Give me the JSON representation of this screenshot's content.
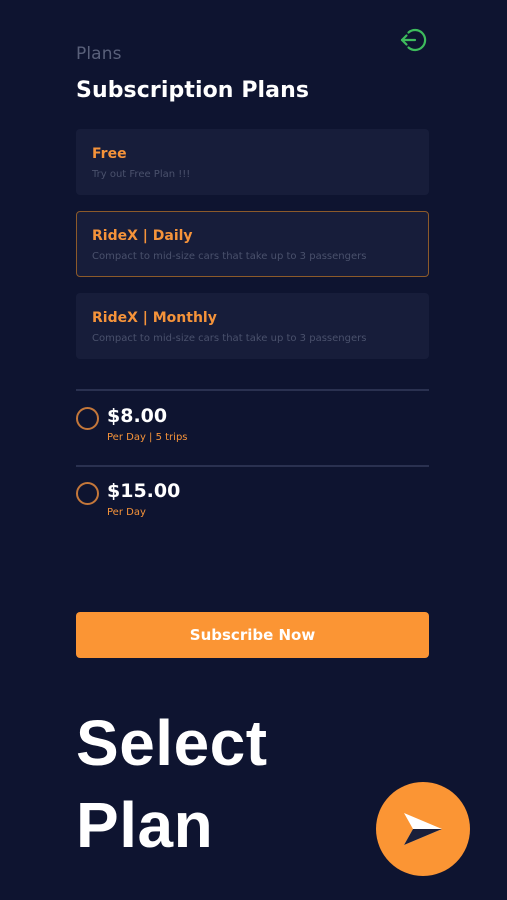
{
  "header": {
    "breadcrumb": "Plans",
    "title": "Subscription Plans",
    "exit_icon": "logout-icon"
  },
  "plans": [
    {
      "name": "Free",
      "description": "Try out Free Plan !!!",
      "selected": false
    },
    {
      "name": "RideX | Daily",
      "description": "Compact to mid-size cars that take up to 3 passengers",
      "selected": true
    },
    {
      "name": "RideX | Monthly",
      "description": "Compact to mid-size cars that take up to 3 passengers",
      "selected": false
    }
  ],
  "prices": [
    {
      "amount": "$8.00",
      "detail": "Per Day | 5 trips",
      "checked": false
    },
    {
      "amount": "$15.00",
      "detail": "Per Day",
      "checked": false
    }
  ],
  "subscribe_label": "Subscribe Now",
  "headline": {
    "line1": "Select",
    "line2": "Plan"
  },
  "brand": {
    "icon": "ridex-arrow-logo-icon"
  },
  "colors": {
    "background": "#0e1430",
    "card": "#171d3a",
    "accent": "#fb9534",
    "exit_icon": "#3dbb5c"
  }
}
